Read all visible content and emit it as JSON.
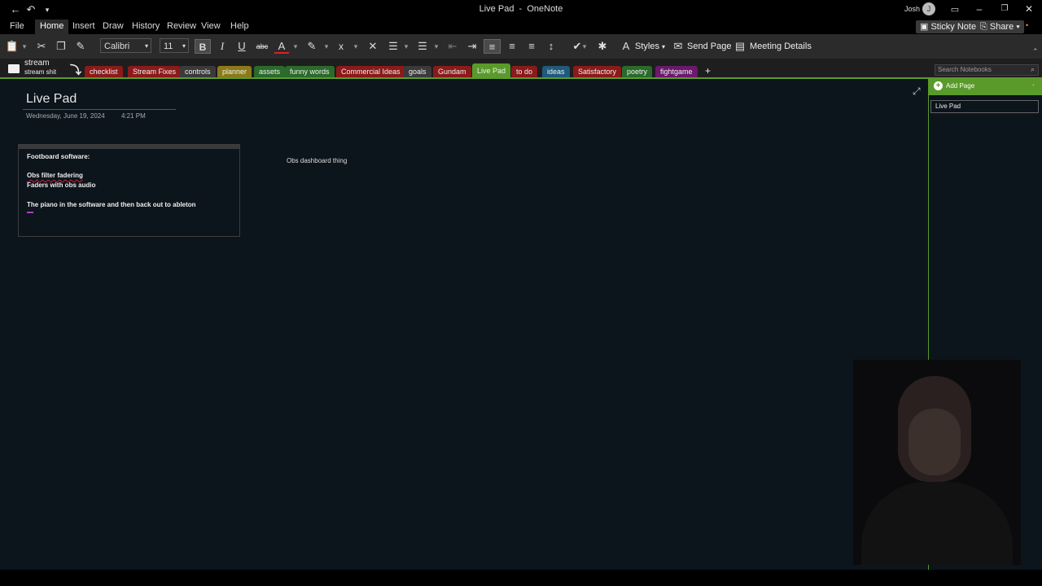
{
  "window": {
    "title": "Live Pad",
    "app": "OneNote",
    "user": "Josh",
    "user_initial": "J"
  },
  "menu": {
    "tabs": [
      "File",
      "Home",
      "Insert",
      "Draw",
      "History",
      "Review",
      "View",
      "Help"
    ],
    "active": "Home",
    "sticky_notes": "Sticky Notes",
    "share": "Share"
  },
  "ribbon": {
    "font_name": "Calibri",
    "font_size": "11",
    "styles_label": "Styles",
    "send_page_label": "Send Page",
    "meeting_details_label": "Meeting Details"
  },
  "notebook": {
    "name": "stream",
    "subtitle": "stream shit",
    "sections": [
      {
        "label": "checklist",
        "color": "#8b1a1a"
      },
      {
        "label": "Stream Fixes",
        "color": "#8b1a1a"
      },
      {
        "label": "controls",
        "color": "#3a3a3a"
      },
      {
        "label": "planner",
        "color": "#8a7a1a"
      },
      {
        "label": "assets",
        "color": "#2a6a2a"
      },
      {
        "label": "funny words",
        "color": "#2a6a2a"
      },
      {
        "label": "Commercial Ideas",
        "color": "#8b1a1a"
      },
      {
        "label": "goals",
        "color": "#3a3a3a"
      },
      {
        "label": "Gundam",
        "color": "#8b1a1a"
      },
      {
        "label": "Live Pad",
        "color": "#5a9a2a"
      },
      {
        "label": "to do",
        "color": "#8b1a1a"
      },
      {
        "label": "ideas",
        "color": "#1f5a7a"
      },
      {
        "label": "Satisfactory",
        "color": "#8b1a1a"
      },
      {
        "label": "poetry",
        "color": "#2a6a2a"
      },
      {
        "label": "fightgame",
        "color": "#6a1a6a"
      }
    ],
    "active_section": "Live Pad",
    "add_section": "+",
    "search_placeholder": "Search Notebooks"
  },
  "page": {
    "title": "Live Pad",
    "date": "Wednesday, June 19, 2024",
    "time": "4:21 PM",
    "note_lines": [
      "Footboard software:",
      "Obs filter fadering",
      "Faders with obs audio",
      "The piano in the software and then back out to ableton"
    ],
    "loose_note": "Obs dashboard thing"
  },
  "pages_pane": {
    "add_page": "Add Page",
    "pages": [
      "Live Pad"
    ]
  }
}
